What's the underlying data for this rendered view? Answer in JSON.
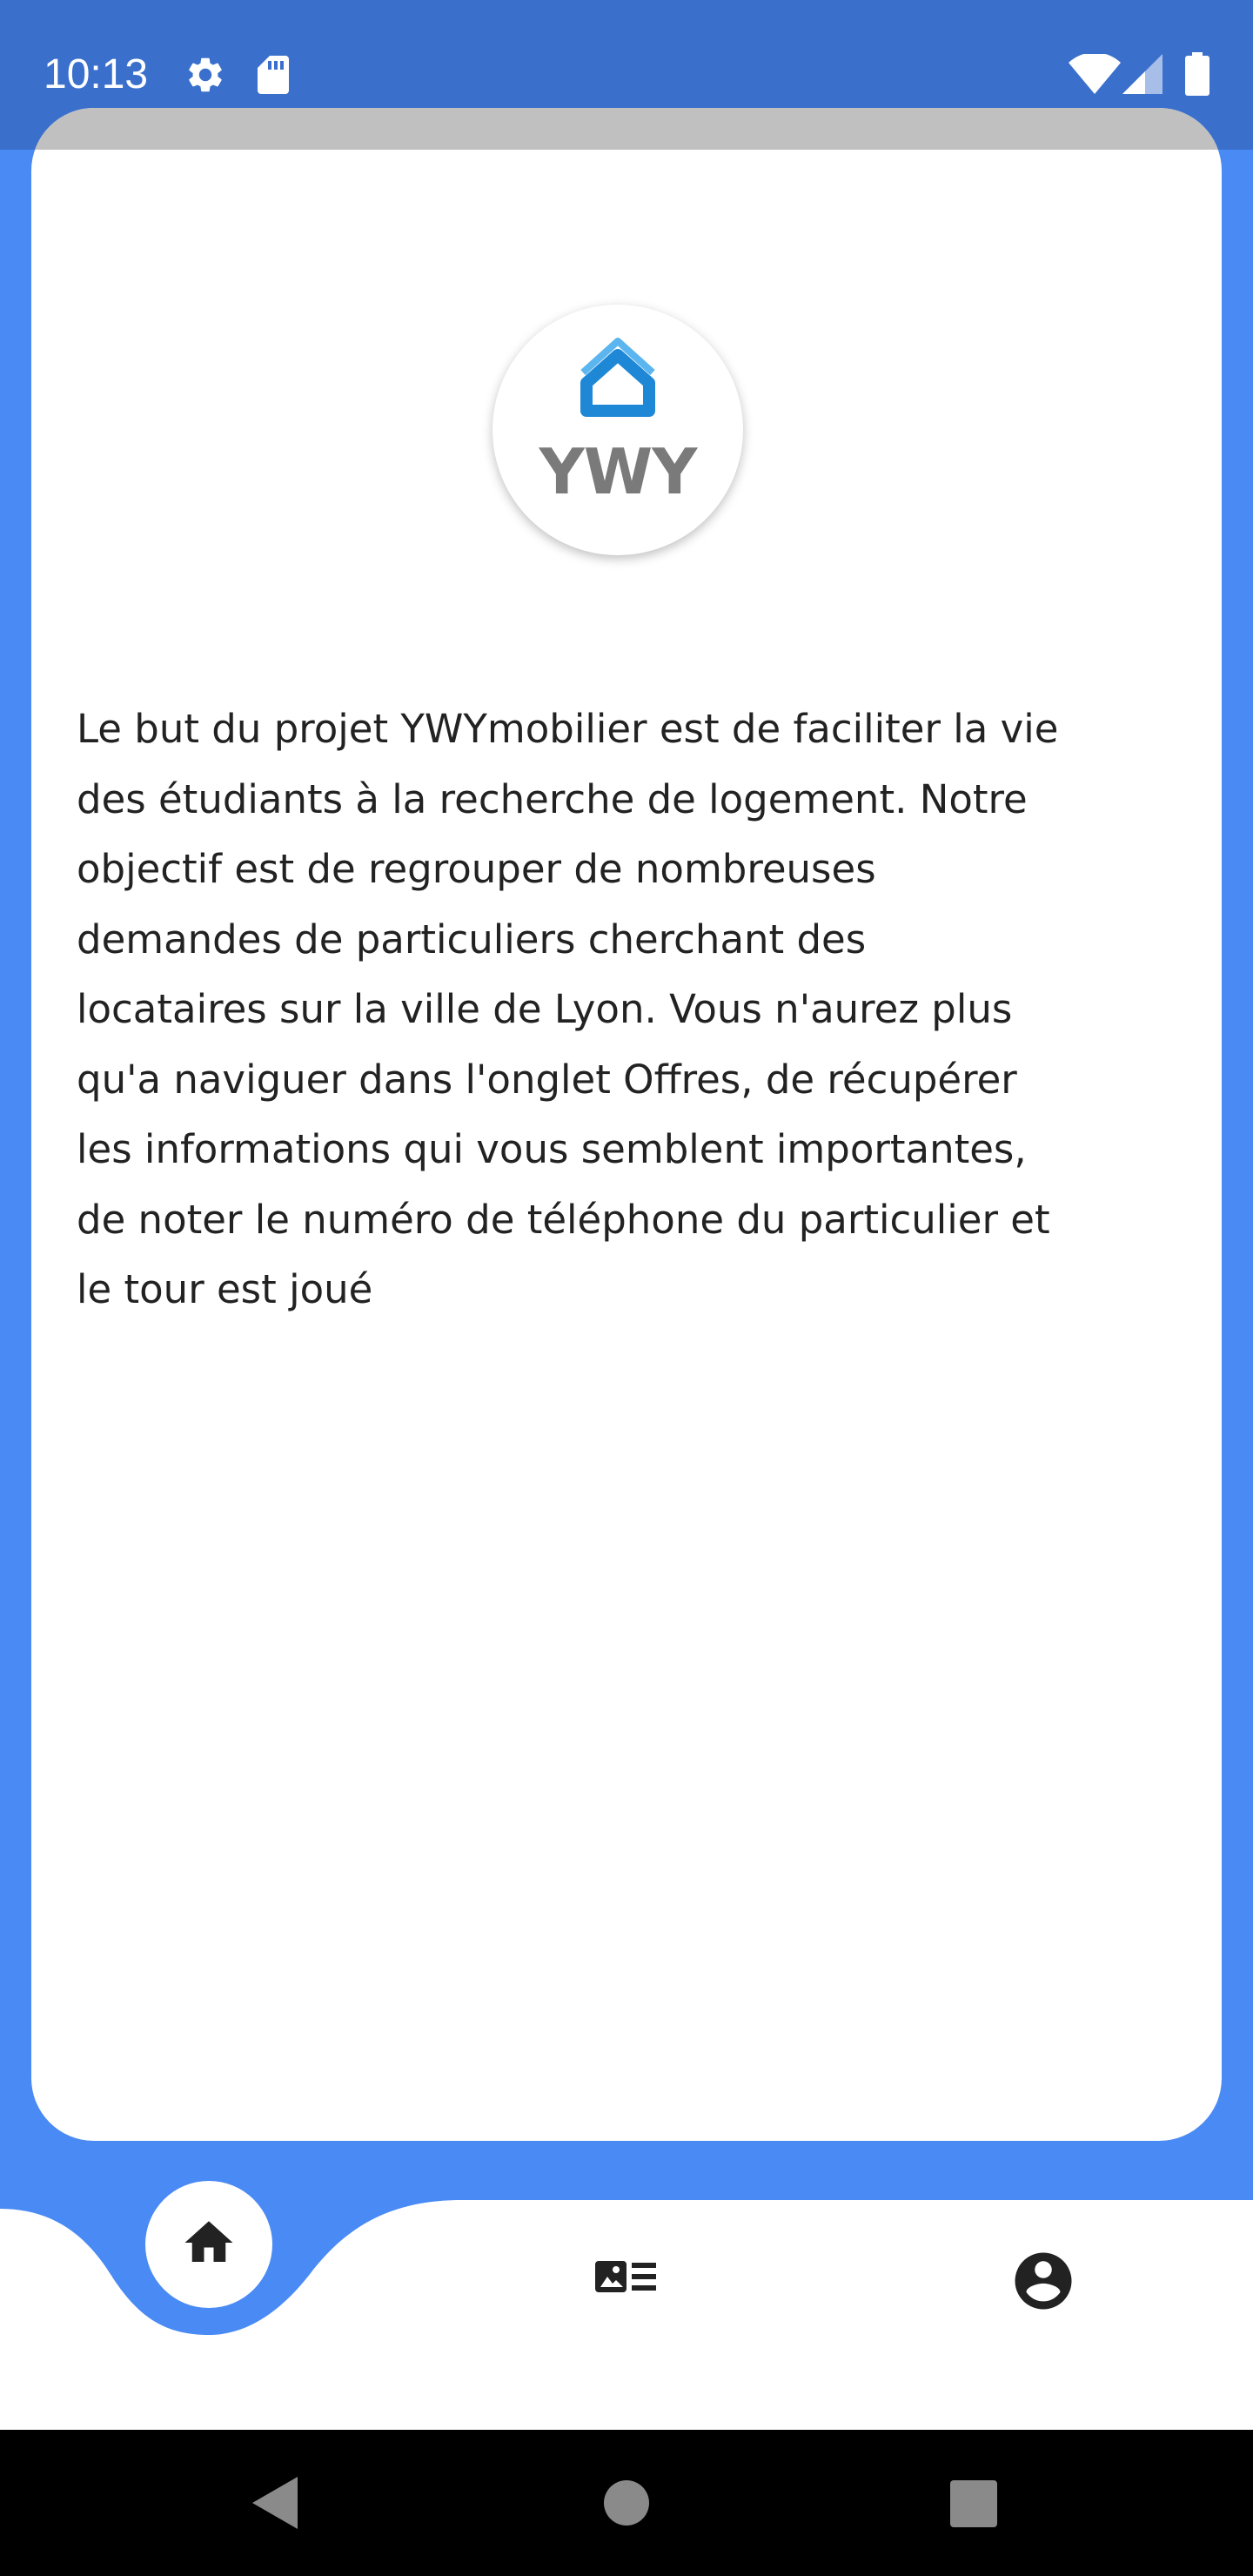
{
  "status_bar": {
    "time": "10:13",
    "icons": [
      "settings-icon",
      "sd-card-icon",
      "wifi-icon",
      "signal-icon",
      "battery-icon"
    ]
  },
  "logo": {
    "text": "YWY",
    "icon": "house-icon"
  },
  "description": "Le but du projet YWYmobilier est de faciliter la vie\ndes étudiants à la recherche de logement. Notre\nobjectif est de regrouper de nombreuses\ndemandes de particuliers cherchant des\nlocataires sur la ville de Lyon. Vous n'aurez plus\nqu'a naviguer dans l'onglet Offres, de récupérer\nles informations qui vous semblent importantes,\nde noter le numéro de téléphone du particulier et\nle tour est joué",
  "bottom_nav": {
    "items": [
      {
        "icon": "home-icon",
        "active": true
      },
      {
        "icon": "offers-list-icon",
        "active": false
      },
      {
        "icon": "account-icon",
        "active": false
      }
    ]
  },
  "system_nav": {
    "items": [
      "back-icon",
      "home-circle-icon",
      "recents-icon"
    ]
  },
  "colors": {
    "primary": "#4a8af4",
    "status_bar": "#3a6fcc",
    "card_header": "#c0c0c0",
    "logo_blue": "#1f88d6",
    "logo_gray": "#7a7a7a"
  }
}
